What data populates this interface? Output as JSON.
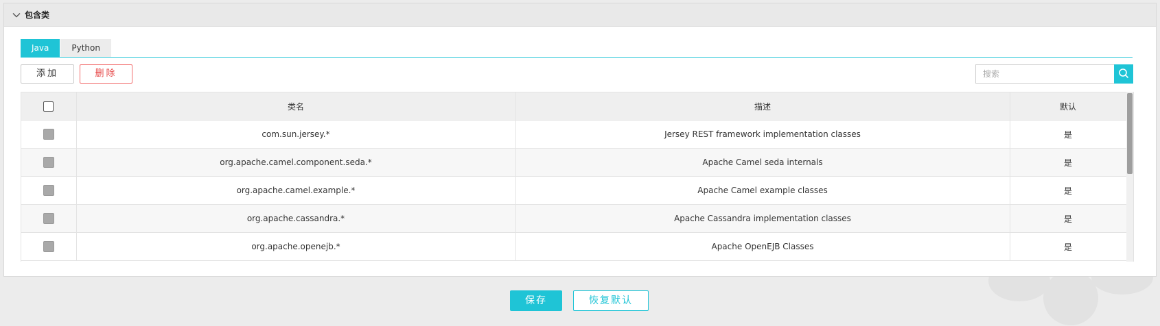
{
  "panel": {
    "title": "包含类"
  },
  "tabs": [
    {
      "label": "Java",
      "active": true
    },
    {
      "label": "Python",
      "active": false
    }
  ],
  "toolbar": {
    "add_label": "添加",
    "delete_label": "删除"
  },
  "search": {
    "placeholder": "搜索",
    "value": ""
  },
  "table": {
    "columns": [
      "类名",
      "描述",
      "默认"
    ],
    "rows": [
      {
        "class_name": "com.sun.jersey.*",
        "description": "Jersey REST framework implementation classes",
        "default": "是"
      },
      {
        "class_name": "org.apache.camel.component.seda.*",
        "description": "Apache Camel seda internals",
        "default": "是"
      },
      {
        "class_name": "org.apache.camel.example.*",
        "description": "Apache Camel example classes",
        "default": "是"
      },
      {
        "class_name": "org.apache.cassandra.*",
        "description": "Apache Cassandra implementation classes",
        "default": "是"
      },
      {
        "class_name": "org.apache.openejb.*",
        "description": "Apache OpenEJB Classes",
        "default": "是"
      }
    ]
  },
  "footer": {
    "save_label": "保存",
    "restore_label": "恢复默认"
  },
  "colors": {
    "accent": "#1fc4d6",
    "danger": "#e64545"
  }
}
